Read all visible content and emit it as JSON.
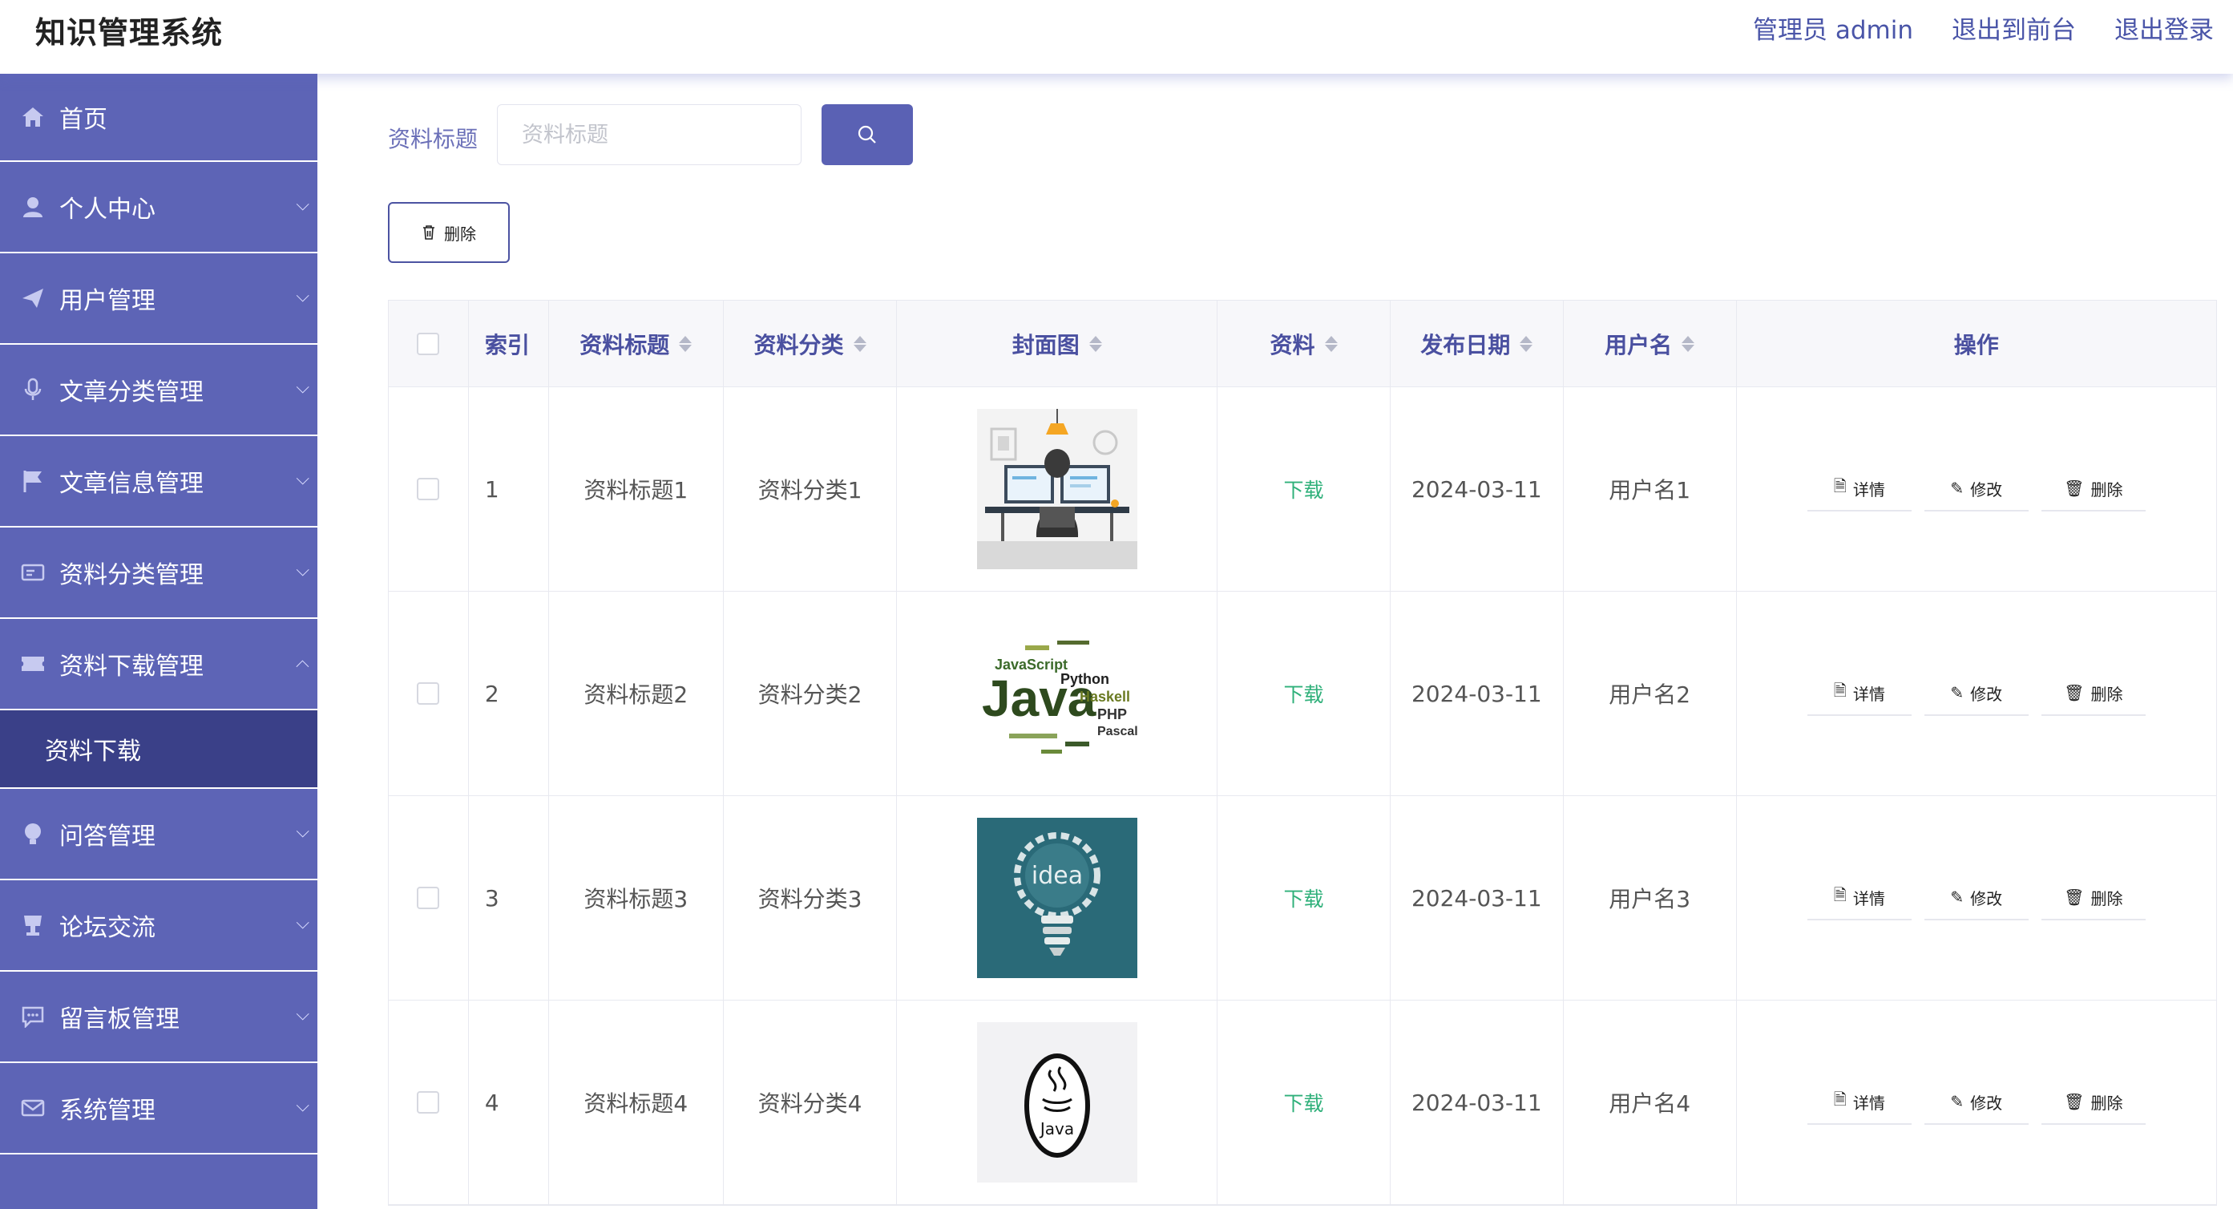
{
  "header": {
    "title": "知识管理系统",
    "admin_label": "管理员 admin",
    "exit_front": "退出到前台",
    "logout": "退出登录"
  },
  "sidebar": {
    "items": [
      {
        "label": "首页",
        "icon": "home-icon"
      },
      {
        "label": "个人中心",
        "icon": "user-icon"
      },
      {
        "label": "用户管理",
        "icon": "send-icon"
      },
      {
        "label": "文章分类管理",
        "icon": "microphone-icon"
      },
      {
        "label": "文章信息管理",
        "icon": "flag-icon"
      },
      {
        "label": "资料分类管理",
        "icon": "card-icon"
      },
      {
        "label": "资料下载管理",
        "icon": "ticket-icon",
        "expanded": true
      },
      {
        "label": "问答管理",
        "icon": "bulb-icon"
      },
      {
        "label": "论坛交流",
        "icon": "cup-icon"
      },
      {
        "label": "留言板管理",
        "icon": "chat-icon"
      },
      {
        "label": "系统管理",
        "icon": "mail-icon"
      }
    ],
    "submenu": {
      "label": "资料下载"
    }
  },
  "search": {
    "label": "资料标题",
    "placeholder": "资料标题",
    "value": ""
  },
  "toolbar": {
    "delete_label": "删除"
  },
  "table": {
    "columns": [
      "索引",
      "资料标题",
      "资料分类",
      "封面图",
      "资料",
      "发布日期",
      "用户名",
      "操作"
    ],
    "rows": [
      {
        "index": "1",
        "title": "资料标题1",
        "category": "资料分类1",
        "cover": "developer-at-desk",
        "file": "下载",
        "date": "2024-03-11",
        "user": "用户名1"
      },
      {
        "index": "2",
        "title": "资料标题2",
        "category": "资料分类2",
        "cover": "java-word-cloud",
        "file": "下载",
        "date": "2024-03-11",
        "user": "用户名2"
      },
      {
        "index": "3",
        "title": "资料标题3",
        "category": "资料分类3",
        "cover": "idea-lightbulb",
        "file": "下载",
        "date": "2024-03-11",
        "user": "用户名3"
      },
      {
        "index": "4",
        "title": "资料标题4",
        "category": "资料分类4",
        "cover": "java-logo",
        "file": "下载",
        "date": "2024-03-11",
        "user": "用户名4"
      }
    ],
    "actions": {
      "detail": "详情",
      "edit": "修改",
      "delete": "删除"
    },
    "cover_texts": {
      "java": "Java",
      "javascript": "JavaScript",
      "python": "Python",
      "haskell": "Haskell",
      "php": "PHP",
      "pascal": "Pascal",
      "idea": "idea",
      "java_logo": "Java"
    }
  },
  "colors": {
    "sidebar": "#5d64b6",
    "sidebar_active": "#3a4088",
    "accent": "#5a61b4",
    "download": "#2fb07a"
  }
}
